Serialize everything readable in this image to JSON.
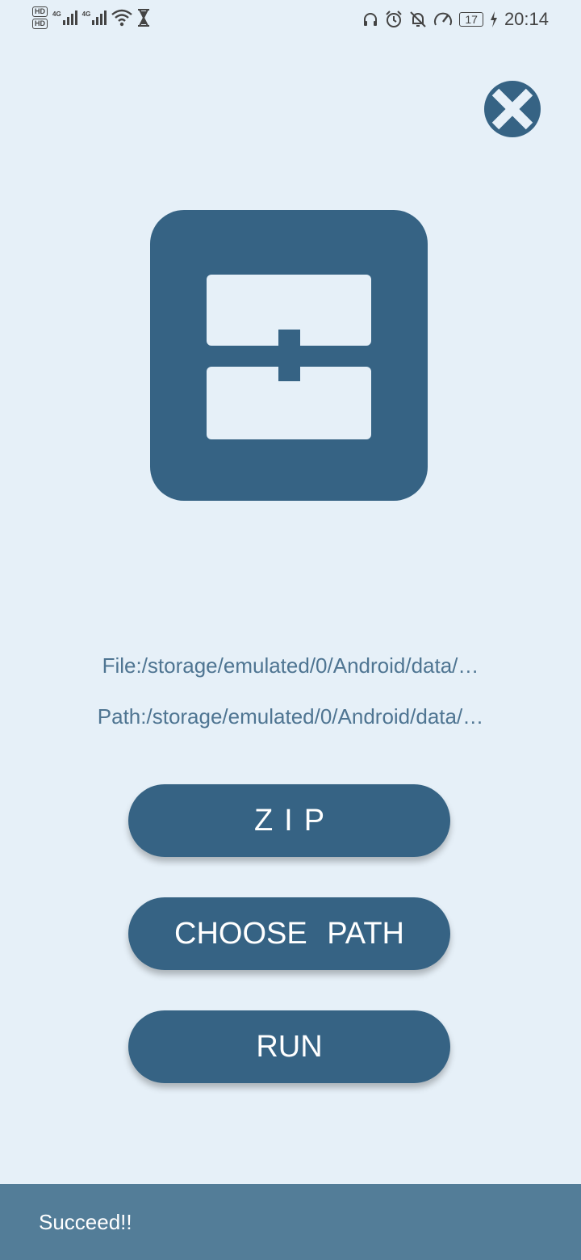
{
  "status_bar": {
    "time": "20:14",
    "battery": "17",
    "left_icons": [
      "hd-1-icon",
      "hd-2-icon",
      "signal-4g-1-icon",
      "signal-4g-2-icon",
      "wifi-icon",
      "hourglass-icon"
    ],
    "right_icons": [
      "headset-icon",
      "alarm-icon",
      "bell-off-icon",
      "speed-icon",
      "battery-icon",
      "charging-icon"
    ],
    "network_label_1": "4G",
    "network_label_2": "4G",
    "hd_label": "HD"
  },
  "close_button": {
    "icon": "close-icon"
  },
  "logo": {
    "icon": "app-logo-icon"
  },
  "info": {
    "file": "File:/storage/emulated/0/Android/data/…",
    "path": "Path:/storage/emulated/0/Android/data/…"
  },
  "buttons": {
    "zip": "ZIP",
    "choose_path": "CHOOSE PATH",
    "run": "RUN"
  },
  "snackbar": {
    "message": "Succeed!!"
  },
  "colors": {
    "background": "#e6f0f8",
    "primary": "#366384",
    "text_info": "#4f7592",
    "snackbar": "#537d98"
  }
}
